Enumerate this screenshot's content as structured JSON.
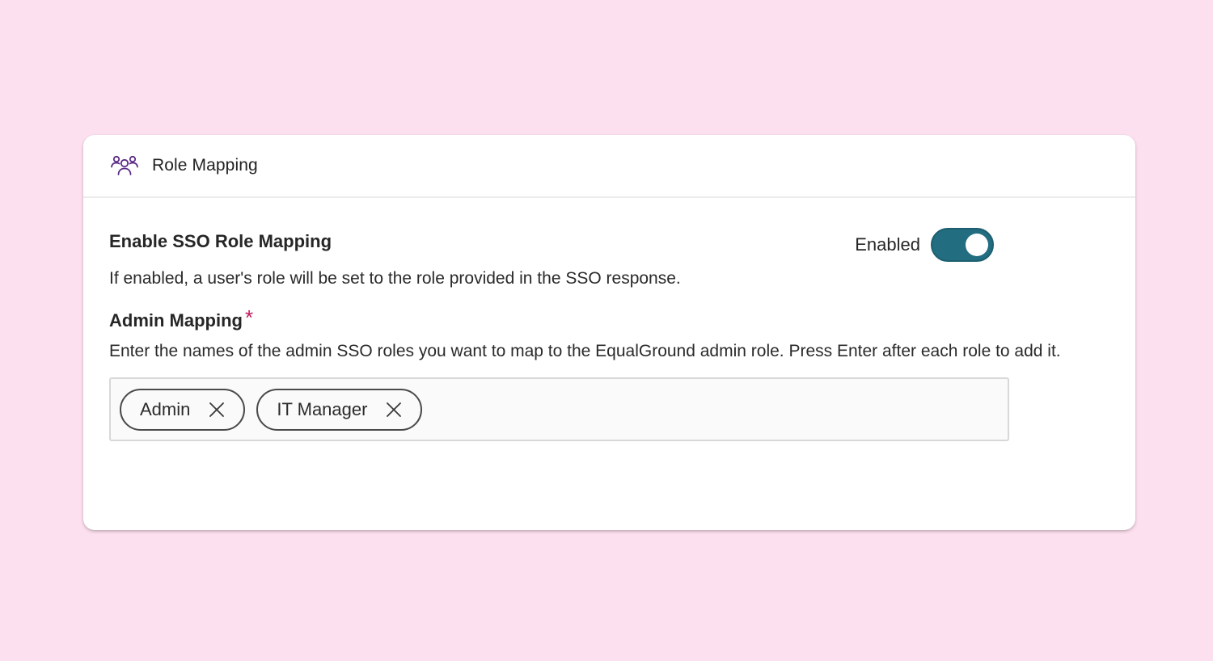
{
  "header": {
    "title": "Role Mapping",
    "icon": "users-group-icon",
    "icon_color": "#5b2a86"
  },
  "sso_mapping": {
    "title": "Enable SSO Role Mapping",
    "description": "If enabled, a user's role will be set to the role provided in the SSO response.",
    "toggle_label": "Enabled",
    "toggle_on": true,
    "toggle_color": "#226d80"
  },
  "admin_mapping": {
    "title": "Admin Mapping",
    "required_marker": "*",
    "description": "Enter the names of the admin SSO roles you want to map to the EqualGround admin role. Press Enter after each role to add it.",
    "tags": [
      {
        "label": "Admin"
      },
      {
        "label": "IT Manager"
      }
    ],
    "input_value": "",
    "input_placeholder": ""
  },
  "colors": {
    "background": "#fde0ef",
    "card": "#ffffff",
    "required": "#c2185b"
  }
}
